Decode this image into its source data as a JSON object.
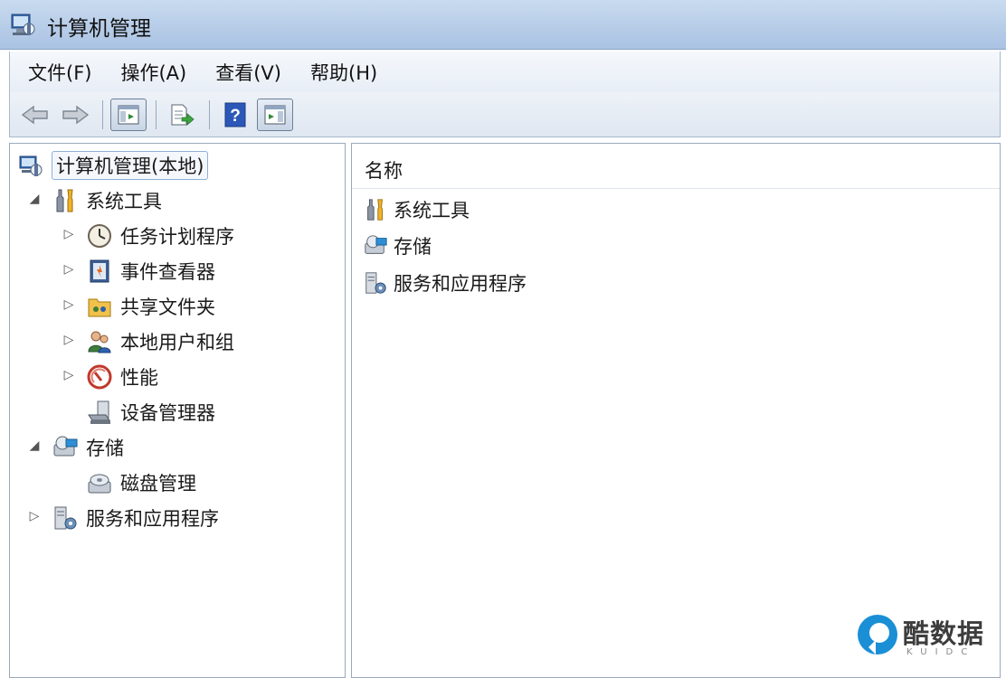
{
  "window": {
    "title": "计算机管理"
  },
  "menu": [
    {
      "label": "文件(F)"
    },
    {
      "label": "操作(A)"
    },
    {
      "label": "查看(V)"
    },
    {
      "label": "帮助(H)"
    }
  ],
  "toolbar": {
    "buttons": [
      "back-arrow-icon",
      "forward-arrow-icon",
      "show-console-tree-icon",
      "export-list-icon",
      "help-icon",
      "show-action-pane-icon"
    ]
  },
  "tree": {
    "root": {
      "label": "计算机管理(本地)"
    },
    "system_tools": {
      "label": "系统工具",
      "children": [
        {
          "label": "任务计划程序"
        },
        {
          "label": "事件查看器"
        },
        {
          "label": "共享文件夹"
        },
        {
          "label": "本地用户和组"
        },
        {
          "label": "性能"
        },
        {
          "label": "设备管理器"
        }
      ]
    },
    "storage": {
      "label": "存储",
      "children": [
        {
          "label": "磁盘管理"
        }
      ]
    },
    "services": {
      "label": "服务和应用程序"
    }
  },
  "list": {
    "column_name": "名称",
    "items": [
      {
        "label": "系统工具"
      },
      {
        "label": "存储"
      },
      {
        "label": "服务和应用程序"
      }
    ]
  },
  "watermark": {
    "brand": "酷数据",
    "sub": "KUIDC"
  },
  "colors": {
    "accent": "#1a8fd6",
    "titlebar": "#b7cde8"
  }
}
